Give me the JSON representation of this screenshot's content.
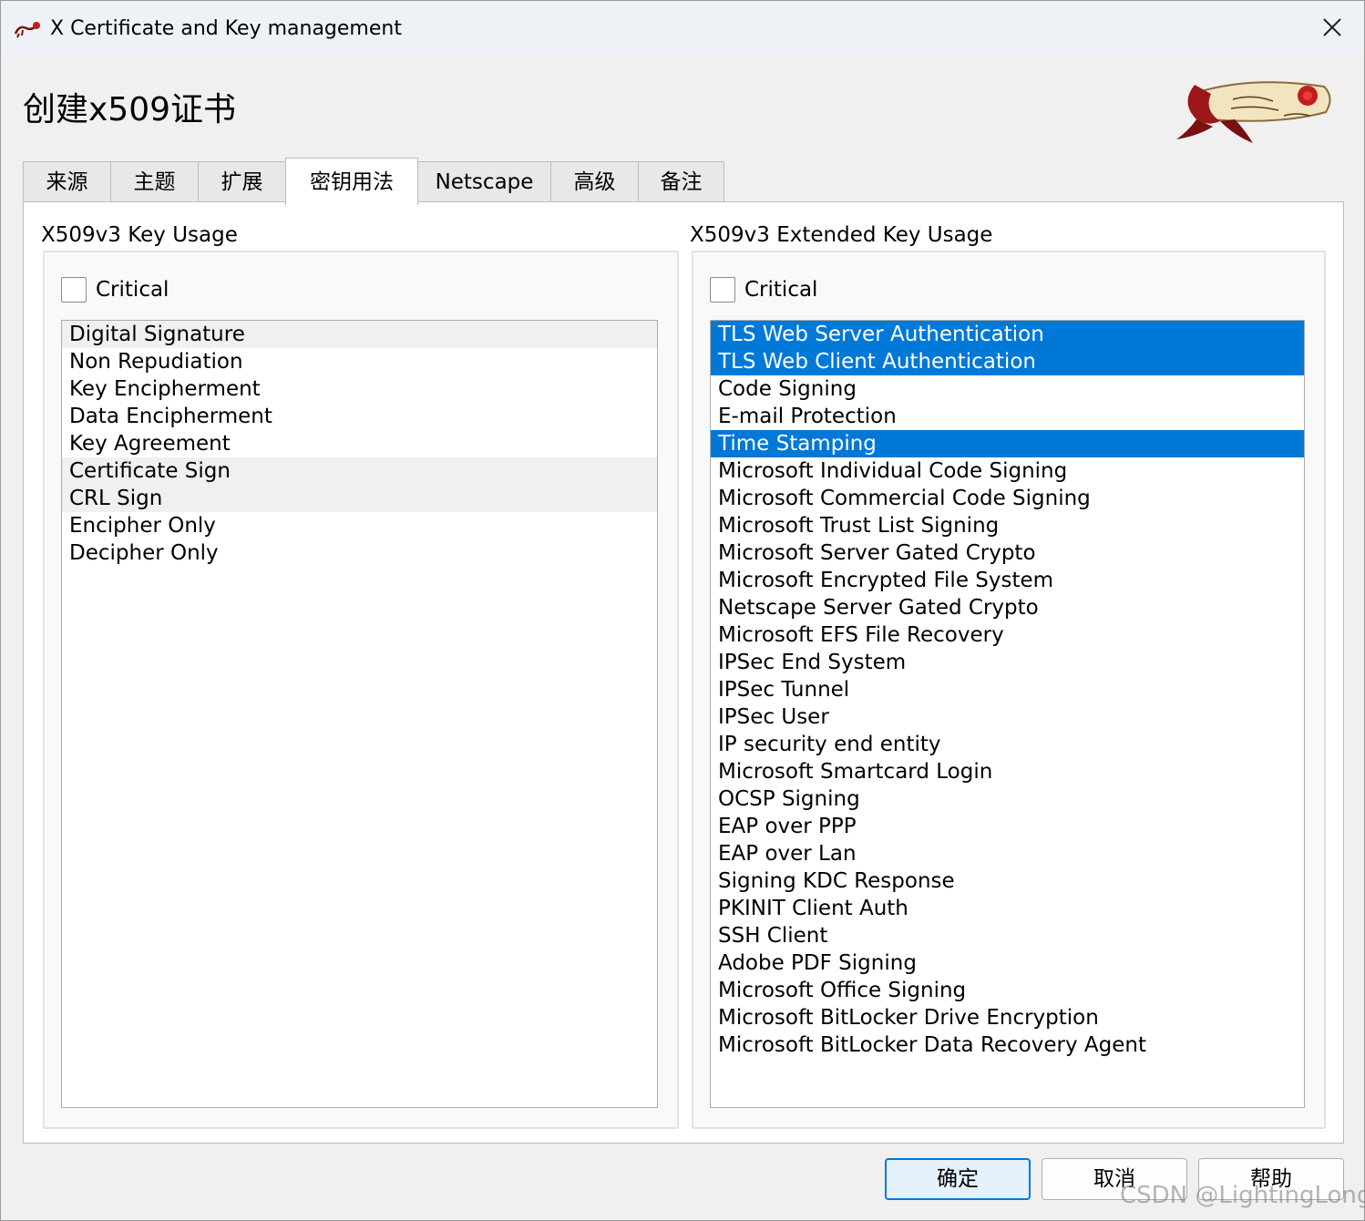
{
  "window": {
    "title": "X Certificate and Key management",
    "page_title": "创建x509证书"
  },
  "tabs": [
    {
      "label": "来源",
      "active": false
    },
    {
      "label": "主题",
      "active": false
    },
    {
      "label": "扩展",
      "active": false
    },
    {
      "label": "密钥用法",
      "active": true
    },
    {
      "label": "Netscape",
      "active": false
    },
    {
      "label": "高级",
      "active": false
    },
    {
      "label": "备注",
      "active": false
    }
  ],
  "key_usage": {
    "title": "X509v3 Key Usage",
    "critical_label": "Critical",
    "critical_checked": false,
    "items": [
      {
        "label": "Digital Signature",
        "state": "highlighted"
      },
      {
        "label": "Non Repudiation",
        "state": "normal"
      },
      {
        "label": "Key Encipherment",
        "state": "normal"
      },
      {
        "label": "Data Encipherment",
        "state": "normal"
      },
      {
        "label": "Key Agreement",
        "state": "normal"
      },
      {
        "label": "Certificate Sign",
        "state": "highlighted"
      },
      {
        "label": "CRL Sign",
        "state": "highlighted"
      },
      {
        "label": "Encipher Only",
        "state": "normal"
      },
      {
        "label": "Decipher Only",
        "state": "normal"
      }
    ]
  },
  "extended_key_usage": {
    "title": "X509v3 Extended Key Usage",
    "critical_label": "Critical",
    "critical_checked": false,
    "items": [
      {
        "label": "TLS Web Server Authentication",
        "state": "selected"
      },
      {
        "label": "TLS Web Client Authentication",
        "state": "selected"
      },
      {
        "label": "Code Signing",
        "state": "normal"
      },
      {
        "label": "E-mail Protection",
        "state": "normal"
      },
      {
        "label": "Time Stamping",
        "state": "selected"
      },
      {
        "label": "Microsoft Individual Code Signing",
        "state": "normal"
      },
      {
        "label": "Microsoft Commercial Code Signing",
        "state": "normal"
      },
      {
        "label": "Microsoft Trust List Signing",
        "state": "normal"
      },
      {
        "label": "Microsoft Server Gated Crypto",
        "state": "normal"
      },
      {
        "label": "Microsoft Encrypted File System",
        "state": "normal"
      },
      {
        "label": "Netscape Server Gated Crypto",
        "state": "normal"
      },
      {
        "label": "Microsoft EFS File Recovery",
        "state": "normal"
      },
      {
        "label": "IPSec End System",
        "state": "normal"
      },
      {
        "label": "IPSec Tunnel",
        "state": "normal"
      },
      {
        "label": "IPSec User",
        "state": "normal"
      },
      {
        "label": "IP security end entity",
        "state": "normal"
      },
      {
        "label": "Microsoft Smartcard Login",
        "state": "normal"
      },
      {
        "label": "OCSP Signing",
        "state": "normal"
      },
      {
        "label": "EAP over PPP",
        "state": "normal"
      },
      {
        "label": "EAP over Lan",
        "state": "normal"
      },
      {
        "label": "Signing KDC Response",
        "state": "normal"
      },
      {
        "label": "PKINIT Client Auth",
        "state": "normal"
      },
      {
        "label": "SSH Client",
        "state": "normal"
      },
      {
        "label": "Adobe PDF Signing",
        "state": "normal"
      },
      {
        "label": "Microsoft Office Signing",
        "state": "normal"
      },
      {
        "label": "Microsoft BitLocker Drive Encryption",
        "state": "normal"
      },
      {
        "label": "Microsoft BitLocker Data Recovery Agent",
        "state": "normal"
      }
    ]
  },
  "buttons": {
    "ok": "确定",
    "cancel": "取消",
    "help": "帮助"
  },
  "watermark": "CSDN @LightingLong",
  "colors": {
    "selection": "#0078d7",
    "highlight": "#f0f0f0",
    "logo_red": "#b01c1c"
  },
  "icons": {
    "app": "xca-app-icon",
    "close": "close-icon",
    "logo": "xca-scroll-logo"
  }
}
